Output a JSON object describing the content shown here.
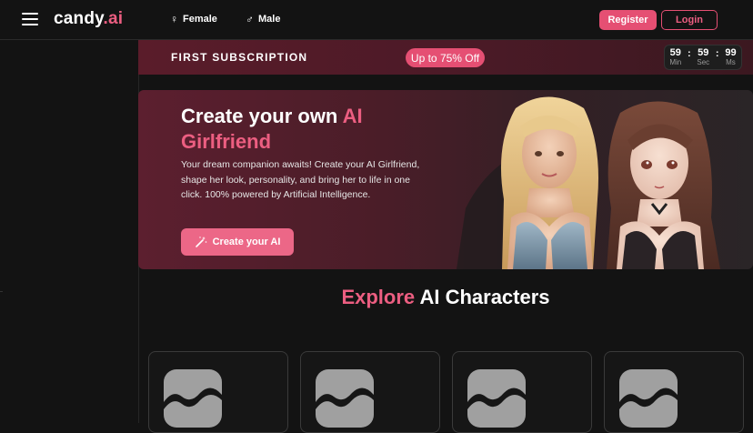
{
  "header": {
    "logo": {
      "text": "candy",
      "accent": ".ai"
    },
    "nav": [
      {
        "icon": "female-icon",
        "label": "Female"
      },
      {
        "icon": "male-icon",
        "label": "Male"
      }
    ],
    "register_label": "Register",
    "login_label": "Login"
  },
  "promo": {
    "title": "FIRST SUBSCRIPTION",
    "badge": "Up to 75% Off",
    "timer": [
      {
        "value": "59",
        "label": "Min"
      },
      {
        "value": "59",
        "label": "Sec"
      },
      {
        "value": "99",
        "label": "Ms"
      }
    ]
  },
  "hero": {
    "title_part1": "Create your own ",
    "title_accent": "AI Girlfriend",
    "description": "Your dream companion awaits! Create your AI Girlfriend, shape her look, personality, and bring her to life in one click. 100% powered by Artificial Intelligence.",
    "button_label": "Create your AI",
    "button_icon": "magic-wand-icon"
  },
  "explore": {
    "accent": "Explore",
    "rest": " AI Characters"
  },
  "cards": [
    {
      "icon": "image-placeholder-icon"
    },
    {
      "icon": "image-placeholder-icon"
    },
    {
      "icon": "image-placeholder-icon"
    },
    {
      "icon": "image-placeholder-icon"
    }
  ],
  "colors": {
    "accent": "#ec5e81",
    "background": "#131313"
  }
}
